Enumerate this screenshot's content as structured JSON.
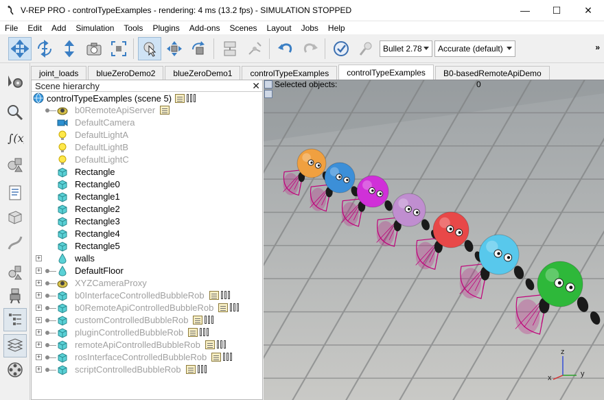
{
  "window": {
    "title": "V-REP PRO - controlTypeExamples - rendering: 4 ms (13.2 fps) - SIMULATION STOPPED",
    "minimize": "—",
    "maximize": "☐",
    "close": "✕"
  },
  "menu": [
    "File",
    "Edit",
    "Add",
    "Simulation",
    "Tools",
    "Plugins",
    "Add-ons",
    "Scenes",
    "Layout",
    "Jobs",
    "Help"
  ],
  "toolbar": {
    "engine": "Bullet 2.78",
    "accuracy": "Accurate (default)",
    "overflow": "»"
  },
  "tabs": [
    "joint_loads",
    "blueZeroDemo2",
    "blueZeroDemo1",
    "controlTypeExamples",
    "controlTypeExamples",
    "B0-basedRemoteApiDemo"
  ],
  "hierarchy": {
    "title": "Scene hierarchy",
    "close": "✕",
    "root": "controlTypeExamples (scene 5)",
    "items": [
      "b0RemoteApiServer",
      "DefaultCamera",
      "DefaultLightA",
      "DefaultLightB",
      "DefaultLightC",
      "Rectangle",
      "Rectangle0",
      "Rectangle1",
      "Rectangle2",
      "Rectangle3",
      "Rectangle4",
      "Rectangle5",
      "walls",
      "DefaultFloor",
      "XYZCameraProxy",
      "b0InterfaceControlledBubbleRob",
      "b0RemoteApiControlledBubbleRob",
      "customControlledBubbleRob",
      "pluginControlledBubbleRob",
      "remoteApiControlledBubbleRob",
      "rosInterfaceControlledBubbleRob",
      "scriptControlledBubbleRob"
    ]
  },
  "viewport": {
    "selected_label": "Selected objects:",
    "selected_count": "0",
    "axis_x": "x",
    "axis_y": "y",
    "axis_z": "z"
  },
  "colors": {
    "robot_orange": "#f0a040",
    "robot_blue": "#3c8fd8",
    "robot_magenta": "#d030d8",
    "robot_lavender": "#c08ed0",
    "robot_red": "#e84848",
    "robot_cyan": "#58c8ec",
    "robot_green": "#2eb83a",
    "sensor_cone": "#c0007a"
  }
}
